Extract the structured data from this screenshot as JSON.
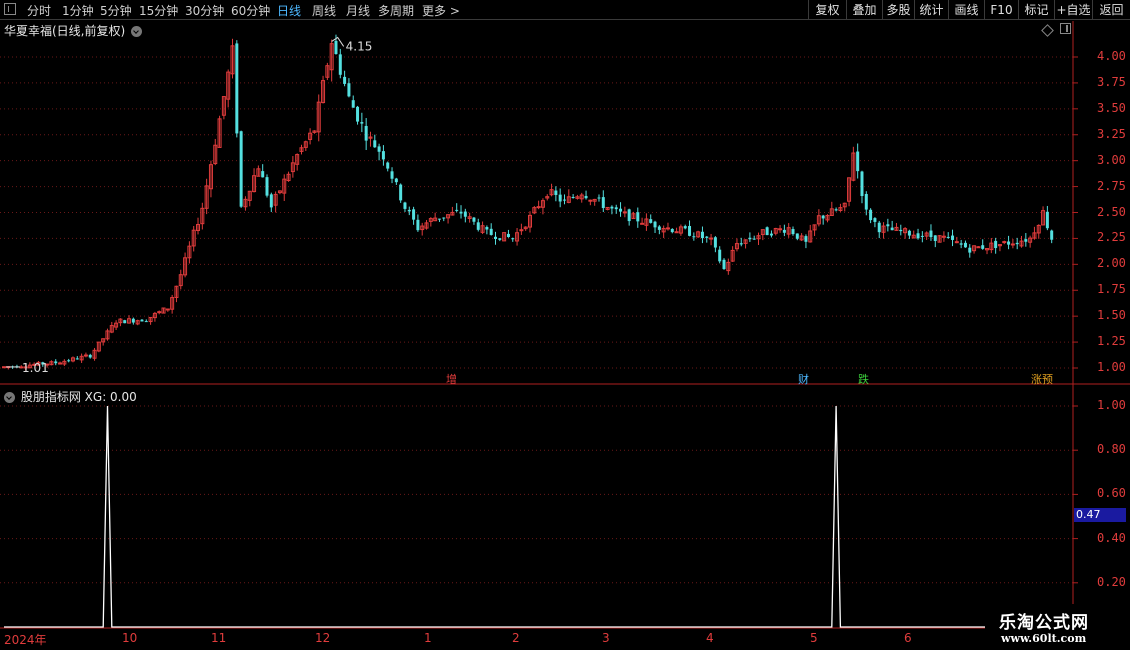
{
  "toolbar": {
    "periods": [
      {
        "label": "分时",
        "active": false
      },
      {
        "label": "1分钟",
        "active": false
      },
      {
        "label": "5分钟",
        "active": false
      },
      {
        "label": "15分钟",
        "active": false
      },
      {
        "label": "30分钟",
        "active": false
      },
      {
        "label": "60分钟",
        "active": false
      },
      {
        "label": "日线",
        "active": true
      },
      {
        "label": "周线",
        "active": false
      },
      {
        "label": "月线",
        "active": false
      },
      {
        "label": "多周期",
        "active": false
      },
      {
        "label": "更多 >",
        "active": false
      }
    ],
    "right_buttons": [
      "复权",
      "叠加",
      "多股",
      "统计",
      "画线",
      "F10",
      "标记",
      "+自选",
      "返回"
    ]
  },
  "main_chart": {
    "title": "华夏幸福(日线,前复权)",
    "high_label": "4.15",
    "low_label": "1.01",
    "y_ticks": [
      "4.00",
      "3.75",
      "3.50",
      "3.25",
      "3.00",
      "2.75",
      "2.50",
      "2.25",
      "2.00",
      "1.75",
      "1.50",
      "1.25",
      "1.00"
    ],
    "markers": [
      {
        "text": "增",
        "color": "#e03c3c"
      },
      {
        "text": "财",
        "color": "#4db8ff"
      },
      {
        "text": "跌",
        "color": "#3cd03c"
      },
      {
        "text": "涨预",
        "color": "#e0a020"
      }
    ],
    "colors": {
      "up": "#e03c3c",
      "down": "#54e0e0",
      "grid": "#6a1818",
      "axis": "#b02020"
    }
  },
  "indicator": {
    "title": "股朋指标网",
    "series_label": "XG: 0.00",
    "y_ticks": [
      "1.00",
      "0.80",
      "0.60",
      "0.40",
      "0.20"
    ],
    "current_value": "0.47",
    "colors": {
      "line": "#ffffff"
    }
  },
  "x_axis": {
    "labels": [
      "2024年",
      "10",
      "11",
      "12",
      "1",
      "2",
      "3",
      "4",
      "5",
      "6"
    ]
  },
  "watermark": {
    "line1": "乐淘公式网",
    "line2": "www.60lt.com"
  },
  "chart_data": {
    "type": "candlestick",
    "x_unit": "trading day index",
    "price_range": [
      0.9,
      4.3
    ],
    "ohlc_keypoints": [
      [
        0,
        1.01
      ],
      [
        12,
        1.05
      ],
      [
        20,
        1.12
      ],
      [
        26,
        1.45
      ],
      [
        33,
        1.47
      ],
      [
        38,
        1.58
      ],
      [
        41,
        1.9
      ],
      [
        46,
        2.55
      ],
      [
        50,
        3.4
      ],
      [
        53,
        4.05
      ],
      [
        55,
        2.55
      ],
      [
        59,
        2.95
      ],
      [
        62,
        2.55
      ],
      [
        68,
        3.05
      ],
      [
        72,
        3.3
      ],
      [
        76,
        4.15
      ],
      [
        80,
        3.6
      ],
      [
        84,
        3.25
      ],
      [
        88,
        3.05
      ],
      [
        93,
        2.55
      ],
      [
        96,
        2.35
      ],
      [
        100,
        2.45
      ],
      [
        106,
        2.5
      ],
      [
        112,
        2.3
      ],
      [
        118,
        2.25
      ],
      [
        122,
        2.45
      ],
      [
        126,
        2.7
      ],
      [
        130,
        2.6
      ],
      [
        134,
        2.7
      ],
      [
        138,
        2.6
      ],
      [
        142,
        2.5
      ],
      [
        148,
        2.42
      ],
      [
        154,
        2.35
      ],
      [
        160,
        2.3
      ],
      [
        164,
        2.22
      ],
      [
        167,
        1.95
      ],
      [
        170,
        2.2
      ],
      [
        176,
        2.3
      ],
      [
        182,
        2.35
      ],
      [
        186,
        2.2
      ],
      [
        189,
        2.45
      ],
      [
        195,
        2.55
      ],
      [
        197,
        3.1
      ],
      [
        200,
        2.5
      ],
      [
        203,
        2.35
      ],
      [
        210,
        2.3
      ],
      [
        218,
        2.25
      ],
      [
        224,
        2.15
      ],
      [
        232,
        2.2
      ],
      [
        238,
        2.25
      ],
      [
        241,
        2.5
      ],
      [
        243,
        2.25
      ]
    ],
    "indicator_name": "XG",
    "indicator_values": [
      {
        "day": 24,
        "value": 1.0
      },
      {
        "day": 193,
        "value": 1.0
      }
    ],
    "indicator_default": 0.0,
    "indicator_range": [
      0.0,
      1.0
    ]
  }
}
